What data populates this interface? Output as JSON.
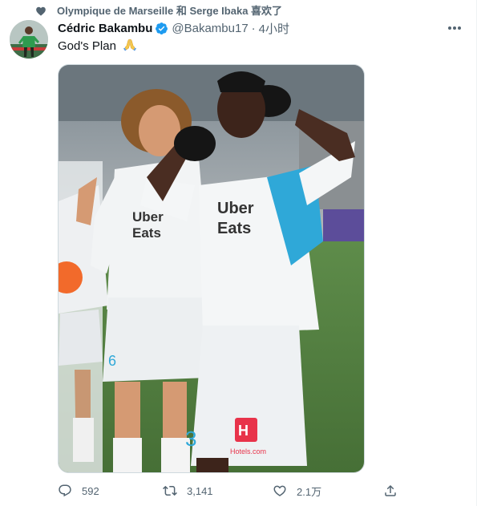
{
  "social_context": {
    "text": "Olympique de Marseille 和 Serge Ibaka 喜欢了",
    "icon": "heart-icon"
  },
  "author": {
    "display_name": "Cédric Bakambu",
    "verified": true,
    "handle": "@Bakambu17",
    "separator": "·",
    "time": "4小时"
  },
  "tweet": {
    "text": "God's Plan",
    "emoji": "folded-hands-emoji"
  },
  "media": {
    "jersey_sponsor": [
      "Uber",
      "Eats"
    ],
    "back_sponsor": "Hotels.com",
    "player_number": "3",
    "teammate_number": "6"
  },
  "actions": {
    "reply_count": "592",
    "retweet_count": "3,141",
    "like_count": "2.1万"
  },
  "colors": {
    "accent": "#1d9bf0",
    "secondary_text": "#536471",
    "primary_text": "#0f1419",
    "om_blue": "#2fa8d8"
  }
}
